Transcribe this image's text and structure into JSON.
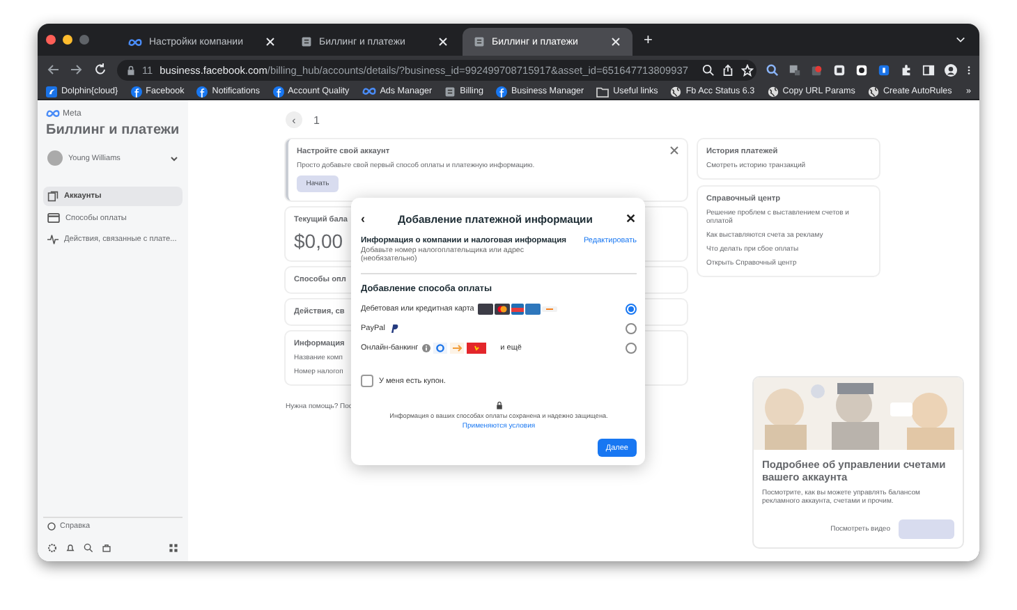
{
  "browser": {
    "tabs": [
      {
        "title": "Настройки компании",
        "kind": "meta",
        "selected": false
      },
      {
        "title": "Биллинг и платежи",
        "kind": "doc",
        "selected": false
      },
      {
        "title": "Биллинг и платежи",
        "kind": "doc",
        "selected": true
      }
    ],
    "new_tab": "+",
    "address": {
      "badge": "11",
      "domain": "business.facebook.com",
      "path": "/billing_hub/accounts/details/?business_id=992499708715917&asset_id=651647713809937"
    },
    "bookmarks": [
      {
        "label": "Dolphin{cloud}",
        "kind": "dolphin"
      },
      {
        "label": "Facebook",
        "kind": "fb"
      },
      {
        "label": "Notifications",
        "kind": "fb"
      },
      {
        "label": "Account Quality",
        "kind": "fb"
      },
      {
        "label": "Ads Manager",
        "kind": "meta"
      },
      {
        "label": "Billing",
        "kind": "doc"
      },
      {
        "label": "Business Manager",
        "kind": "fb"
      },
      {
        "label": "Useful links",
        "kind": "folder"
      },
      {
        "label": "Fb Acc Status 6.3",
        "kind": "globe"
      },
      {
        "label": "Copy URL Params",
        "kind": "globe"
      },
      {
        "label": "Create AutoRules",
        "kind": "globe"
      }
    ],
    "more": "»"
  },
  "sidebar": {
    "brand": "Meta",
    "title": "Биллинг и платежи",
    "account": "Young Williams",
    "items": [
      {
        "label": "Аккаунты",
        "kind": "accounts",
        "selected": true
      },
      {
        "label": "Способы оплаты",
        "kind": "card",
        "selected": false
      },
      {
        "label": "Действия, связанные с плате...",
        "kind": "pulse",
        "selected": false
      }
    ],
    "help": "Справка"
  },
  "main": {
    "back": "‹",
    "page": "1",
    "setup": {
      "title": "Настройте свой аккаунт",
      "text": "Просто добавьте свой первый способ оплаты и платежную информацию.",
      "button": "Начать"
    },
    "cards": [
      {
        "title": "Текущий бала",
        "value": "$0,00"
      },
      {
        "title": "Способы опл"
      },
      {
        "title": "Действия, св"
      },
      {
        "title": "Информация",
        "lines": [
          "Название комп",
          "Номер налогоп"
        ]
      }
    ],
    "help_text": "Нужна помощь? Пос",
    "history": {
      "title": "История платежей",
      "link": "Смотреть историю транзакций"
    },
    "help_center": {
      "title": "Справочный центр",
      "links": [
        "Решение проблем с выставлением счетов и оплатой",
        "Как выставляются счета за рекламу",
        "Что делать при сбое оплаты",
        "Открыть Справочный центр"
      ]
    },
    "promo": {
      "kind": "picture",
      "title": "Подробнее об управлении счетами вашего аккаунта",
      "text": "Посмотрите, как вы можете управлять балансом рекламного аккаунта, счетами и прочим.",
      "button": "Посмотреть видео"
    }
  },
  "modal": {
    "back": "‹",
    "title": "Добавление платежной информации",
    "close": "✕",
    "company": {
      "title": "Информация о компании и налоговая информация",
      "subtitle": "Добавьте номер налогоплательщика или адрес (необязательно)",
      "edit": "Редактировать"
    },
    "methods_title": "Добавление способа оплаты",
    "methods": [
      {
        "label": "Дебетовая или кредитная карта",
        "kind": "cards",
        "selected": true
      },
      {
        "label": "PayPal",
        "kind": "paypal",
        "selected": false
      },
      {
        "label": "Онлайн-банкинг",
        "kind": "banks",
        "extra": "и ещё",
        "selected": false
      }
    ],
    "coupon": {
      "label": "У меня есть купон.",
      "checked": false
    },
    "security": "Информация о ваших способах оплаты сохранена и надежно защищена.",
    "terms": "Применяются условия",
    "next": "Далее"
  }
}
